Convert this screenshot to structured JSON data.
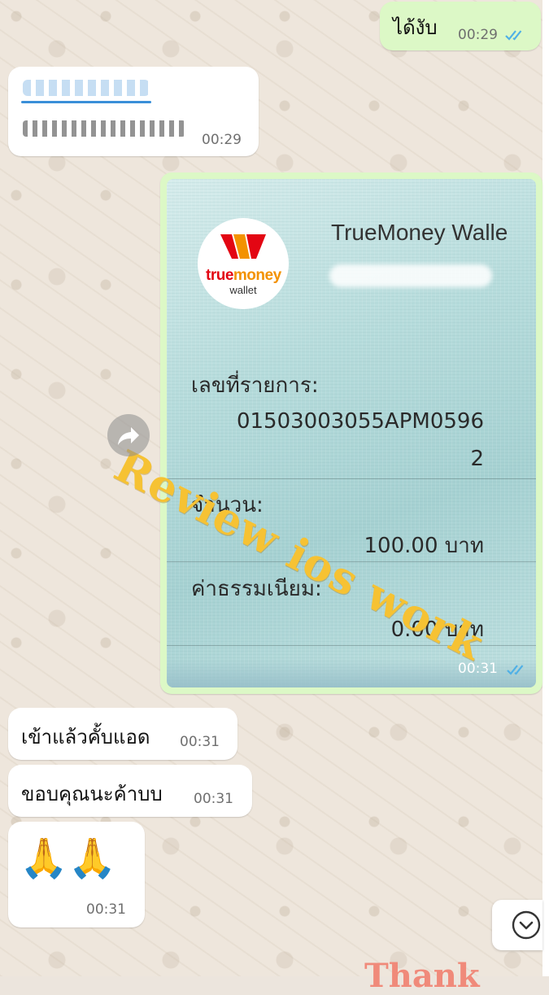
{
  "colors": {
    "outgoing_bubble": "#dcf8c6",
    "incoming_bubble": "#ffffff",
    "read_ticks": "#4fb0e6",
    "watermark": "#f6c233"
  },
  "messages": [
    {
      "id": "m1",
      "direction": "out",
      "text": "ได้งับ",
      "time": "00:29",
      "read": true
    },
    {
      "id": "m2",
      "direction": "in",
      "text": "",
      "time": "00:29"
    },
    {
      "id": "m3",
      "direction": "out",
      "type": "image",
      "time": "00:31",
      "read": true
    },
    {
      "id": "m4",
      "direction": "in",
      "text": "เข้าแล้วคั้บแอด",
      "time": "00:31"
    },
    {
      "id": "m5",
      "direction": "in",
      "text": "ขอบคุณนะค้าบบ",
      "time": "00:31"
    },
    {
      "id": "m6",
      "direction": "in",
      "text": "🙏🙏",
      "time": "00:31"
    }
  ],
  "receipt": {
    "logo_text_true": "true",
    "logo_text_money": "money",
    "logo_text_wallet": "wallet",
    "title": "TrueMoney Walle",
    "transaction_label": "เลขที่รายการ:",
    "transaction_value_line1": "01503003055APM0596",
    "transaction_value_line2": "2",
    "amount_label": "จำนวน:",
    "amount_value": "100.00 บาท",
    "fee_label": "ค่าธรรมเนียม:",
    "fee_value": "0.00 บาท"
  },
  "watermark": {
    "text": "Review ios work"
  },
  "bottom_text": "Thank",
  "icons": {
    "forward": "forward-arrow-icon",
    "scroll_down": "chevron-down-icon",
    "double_check": "double-check-icon"
  }
}
